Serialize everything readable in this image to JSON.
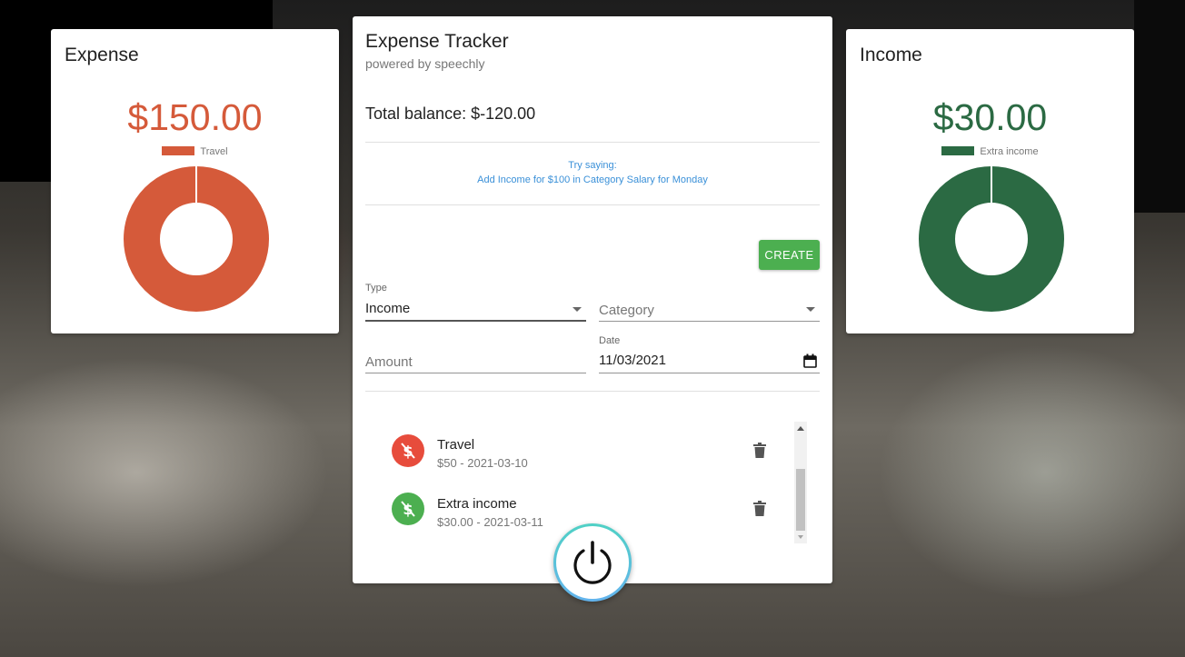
{
  "expense": {
    "title": "Expense",
    "amount": "$150.00",
    "legend": "Travel",
    "color": "#d55a3a"
  },
  "income": {
    "title": "Income",
    "amount": "$30.00",
    "legend": "Extra income",
    "color": "#2b6a43"
  },
  "tracker": {
    "title": "Expense Tracker",
    "subtitle": "powered by speechly",
    "balance": "Total balance: $-120.00",
    "hint_line1": "Try saying:",
    "hint_line2": "Add Income for $100 in Category Salary for Monday",
    "create_label": "CREATE",
    "form": {
      "type_label": "Type",
      "type_value": "Income",
      "category_placeholder": "Category",
      "amount_placeholder": "Amount",
      "date_label": "Date",
      "date_value": "11/03/2021"
    },
    "transactions": [
      {
        "name": "Travel",
        "detail": "$50 - 2021-03-10",
        "kind": "expense",
        "avatar_color": "#e74c3c",
        "icon": "money-off-icon"
      },
      {
        "name": "Extra income",
        "detail": "$30.00 - 2021-03-11",
        "kind": "income",
        "avatar_color": "#4caf50",
        "icon": "money-off-icon"
      }
    ]
  },
  "chart_data": [
    {
      "type": "pie",
      "title": "Expense",
      "categories": [
        "Travel"
      ],
      "values": [
        150
      ],
      "colors": [
        "#d55a3a"
      ]
    },
    {
      "type": "pie",
      "title": "Income",
      "categories": [
        "Extra income"
      ],
      "values": [
        30
      ],
      "colors": [
        "#2b6a43"
      ]
    }
  ]
}
